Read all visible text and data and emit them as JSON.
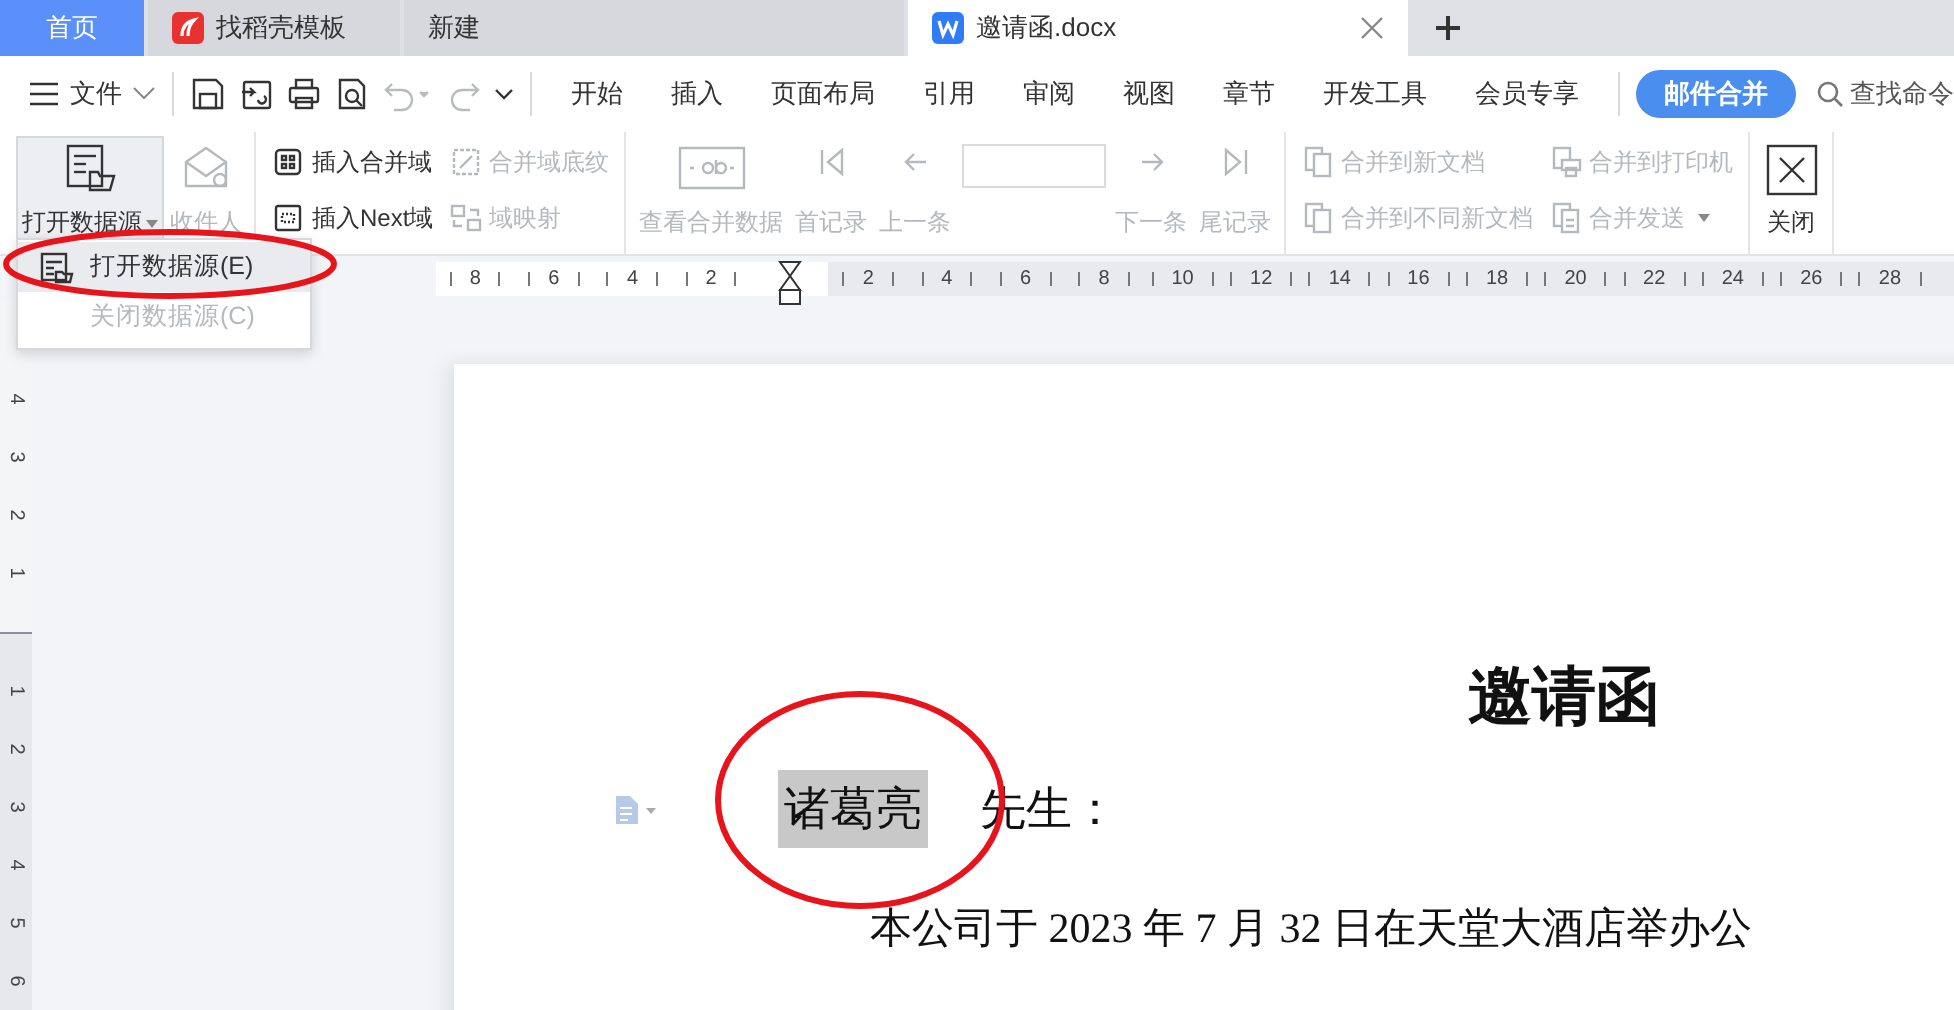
{
  "tabs": [
    {
      "label": "首页",
      "kind": "home",
      "selected": false
    },
    {
      "label": "找稻壳模板",
      "kind": "template",
      "selected": false
    },
    {
      "label": "新建",
      "kind": "plain",
      "selected": false
    },
    {
      "label": "邀请函.docx",
      "kind": "document",
      "selected": true
    }
  ],
  "menu": {
    "file_label": "文件",
    "quick_access": [
      {
        "disabled": false
      },
      {
        "disabled": false
      },
      {
        "disabled": false
      },
      {
        "disabled": false
      },
      {
        "disabled": true
      },
      {
        "disabled": true
      },
      {
        "disabled": false
      }
    ],
    "tabs": [
      {
        "label": "开始",
        "selected": false
      },
      {
        "label": "插入",
        "selected": false
      },
      {
        "label": "页面布局",
        "selected": false
      },
      {
        "label": "引用",
        "selected": false
      },
      {
        "label": "审阅",
        "selected": false
      },
      {
        "label": "视图",
        "selected": false
      },
      {
        "label": "章节",
        "selected": false
      },
      {
        "label": "开发工具",
        "selected": false
      },
      {
        "label": "会员专享",
        "selected": false
      },
      {
        "label": "邮件合并",
        "selected": true
      }
    ],
    "search_placeholder": "查找命令"
  },
  "ribbon": {
    "groups": [
      {
        "columns": [
          [
            {
              "label": "打开数据源",
              "kind": "large",
              "disabled": false,
              "dropdown": true,
              "pressed": true
            }
          ],
          [
            {
              "label": "收件人",
              "kind": "large",
              "disabled": true,
              "dropdown": false,
              "pressed": false
            }
          ]
        ]
      },
      {
        "columns": [
          [
            {
              "label": "插入合并域",
              "kind": "small",
              "disabled": false,
              "dropdown": false
            },
            {
              "label": "插入Next域",
              "kind": "small",
              "disabled": false,
              "dropdown": false
            }
          ],
          [
            {
              "label": "合并域底纹",
              "kind": "small",
              "disabled": true,
              "dropdown": false
            },
            {
              "label": "域映射",
              "kind": "small",
              "disabled": true,
              "dropdown": false
            }
          ]
        ]
      },
      {
        "columns": [
          [
            {
              "label": "查看合并数据",
              "kind": "large",
              "disabled": true,
              "dropdown": false,
              "pressed": false
            }
          ],
          [
            {
              "label": "首记录",
              "kind": "large",
              "disabled": true,
              "dropdown": false,
              "pressed": false
            }
          ],
          [
            {
              "label": "上一条",
              "kind": "large",
              "disabled": true,
              "dropdown": false,
              "pressed": false
            }
          ],
          [
            {
              "kind": "field",
              "disabled": true
            }
          ],
          [
            {
              "label": "下一条",
              "kind": "large",
              "disabled": true,
              "dropdown": false,
              "pressed": false
            }
          ],
          [
            {
              "label": "尾记录",
              "kind": "large",
              "disabled": true,
              "dropdown": false,
              "pressed": false
            }
          ]
        ]
      },
      {
        "columns": [
          [
            {
              "label": "合并到新文档",
              "kind": "small",
              "disabled": true,
              "dropdown": false
            },
            {
              "label": "合并到不同新文档",
              "kind": "small",
              "disabled": true,
              "dropdown": false
            }
          ],
          [
            {
              "label": "合并到打印机",
              "kind": "small",
              "disabled": true,
              "dropdown": false
            },
            {
              "label": "合并发送",
              "kind": "small",
              "disabled": true,
              "dropdown": true
            }
          ]
        ]
      },
      {
        "columns": [
          [
            {
              "label": "关闭",
              "kind": "large",
              "disabled": false,
              "dropdown": false,
              "pressed": false
            }
          ]
        ]
      }
    ]
  },
  "dropdown_menu": {
    "items": [
      {
        "label": "打开数据源(E)",
        "highlighted": true,
        "disabled": false
      },
      {
        "label": "关闭数据源(C)",
        "highlighted": false,
        "disabled": true
      }
    ]
  },
  "horizontal_ruler": {
    "left_labels": [
      "8",
      "6",
      "4",
      "2"
    ],
    "right_labels": [
      "2",
      "4",
      "6",
      "8",
      "10",
      "12",
      "14",
      "16",
      "18",
      "20",
      "22",
      "24",
      "26",
      "28"
    ]
  },
  "vertical_ruler": {
    "top_labels": [
      "4",
      "3",
      "2",
      "1"
    ],
    "bottom_labels": [
      "1",
      "2",
      "3",
      "4",
      "5",
      "6"
    ]
  },
  "document": {
    "title": "邀请函",
    "salutation": {
      "field": "诸葛亮",
      "field_highlighted": true,
      "text": "先生："
    },
    "body": "本公司于 2023 年 7 月 32 日在天堂大酒店举办公"
  }
}
